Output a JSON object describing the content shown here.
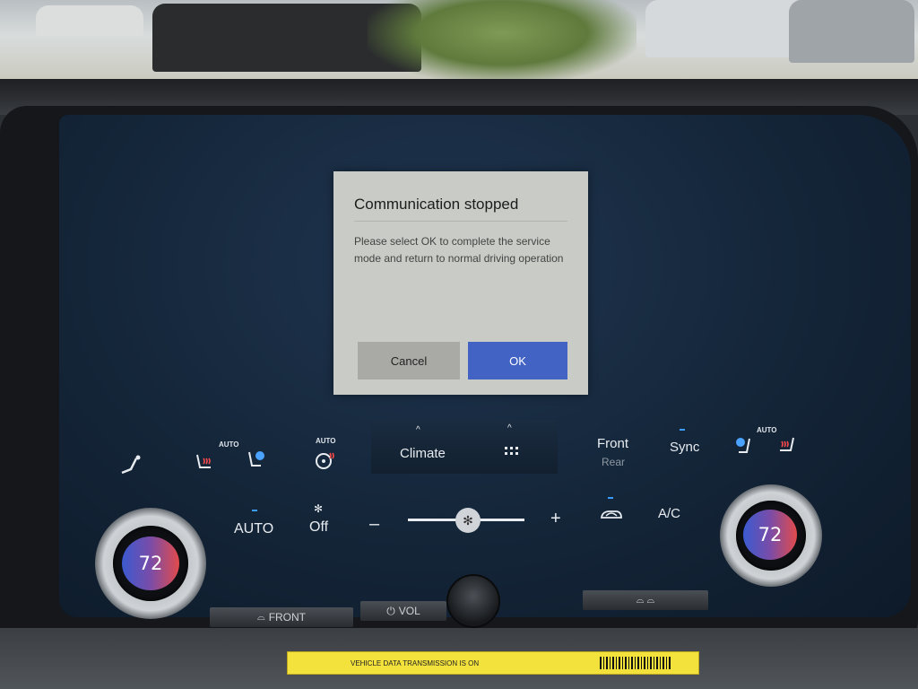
{
  "dialog": {
    "title": "Communication stopped",
    "message": "Please select OK to complete the service mode and return to normal driving operation",
    "cancel_label": "Cancel",
    "ok_label": "OK"
  },
  "climate": {
    "seat_auto_left": "AUTO",
    "wheel_auto": "AUTO",
    "seat_auto_right": "AUTO",
    "climate_label": "Climate",
    "climate_caret": "^",
    "menu_caret": "^",
    "front_label": "Front",
    "rear_label": "Rear",
    "sync_label": "Sync",
    "auto_label": "AUTO",
    "fan_off_label": "Off",
    "minus": "–",
    "plus": "+",
    "ac_label": "A/C",
    "temp_left": "72",
    "temp_right": "72"
  },
  "hardware": {
    "front_defrost_label": "FRONT",
    "vol_label": "VOL"
  },
  "sticker_text": "VEHICLE DATA TRANSMISSION IS ON"
}
